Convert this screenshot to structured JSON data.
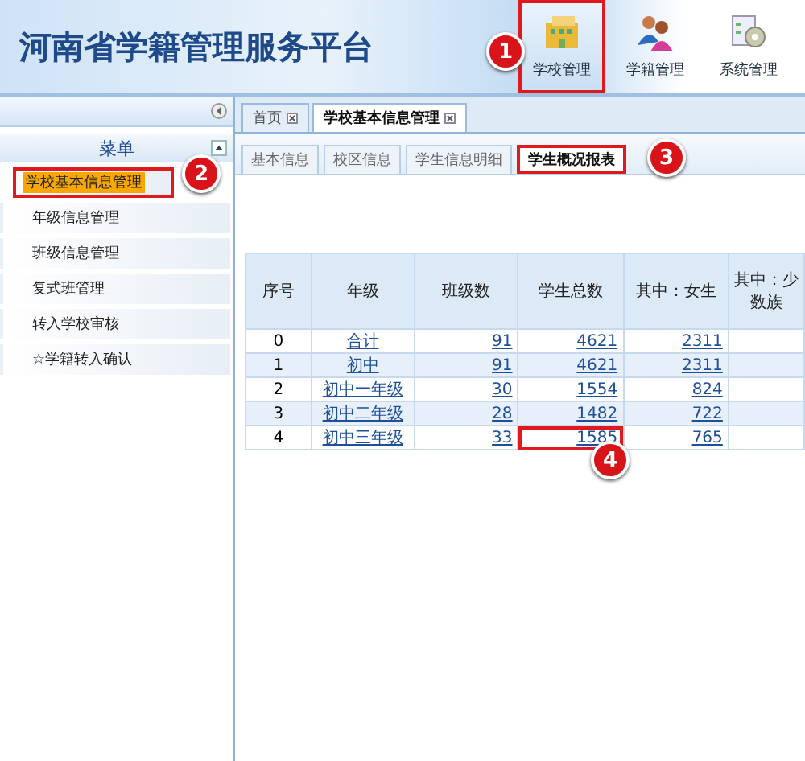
{
  "header": {
    "title": "河南省学籍管理服务平台",
    "nav": [
      {
        "label": "学校管理",
        "kind": "building",
        "selected": true,
        "marked": true
      },
      {
        "label": "学籍管理",
        "kind": "people",
        "selected": false,
        "marked": false
      },
      {
        "label": "系统管理",
        "kind": "gear",
        "selected": false,
        "marked": false
      }
    ]
  },
  "sidebar": {
    "title": "菜单",
    "items": [
      {
        "label": "学校基本信息管理",
        "selected": true,
        "marked": true
      },
      {
        "label": "年级信息管理",
        "selected": false,
        "marked": false
      },
      {
        "label": "班级信息管理",
        "selected": false,
        "marked": false
      },
      {
        "label": "复式班管理",
        "selected": false,
        "marked": false
      },
      {
        "label": "转入学校审核",
        "selected": false,
        "marked": false
      },
      {
        "label": "☆学籍转入确认",
        "selected": false,
        "marked": false
      }
    ]
  },
  "tabs": [
    {
      "label": "首页",
      "selected": false
    },
    {
      "label": "学校基本信息管理",
      "selected": true
    }
  ],
  "subtabs": [
    {
      "label": "基本信息",
      "selected": false,
      "marked": false
    },
    {
      "label": "校区信息",
      "selected": false,
      "marked": false
    },
    {
      "label": "学生信息明细",
      "selected": false,
      "marked": false
    },
    {
      "label": "学生概况报表",
      "selected": true,
      "marked": true
    }
  ],
  "table": {
    "columns": [
      "序号",
      "年级",
      "班级数",
      "学生总数",
      "其中：女生",
      "其中：少数族"
    ],
    "rows": [
      {
        "cells": [
          {
            "text": "0",
            "marked": false
          },
          {
            "text": "合计",
            "marked": false
          },
          {
            "text": "91",
            "marked": false
          },
          {
            "text": "4621",
            "marked": false
          },
          {
            "text": "2311",
            "marked": false
          }
        ]
      },
      {
        "cells": [
          {
            "text": "1",
            "marked": false
          },
          {
            "text": "初中",
            "marked": false
          },
          {
            "text": "91",
            "marked": false
          },
          {
            "text": "4621",
            "marked": false
          },
          {
            "text": "2311",
            "marked": false
          }
        ]
      },
      {
        "cells": [
          {
            "text": "2",
            "marked": false
          },
          {
            "text": "初中一年级",
            "marked": false
          },
          {
            "text": "30",
            "marked": false
          },
          {
            "text": "1554",
            "marked": false
          },
          {
            "text": "824",
            "marked": false
          }
        ]
      },
      {
        "cells": [
          {
            "text": "3",
            "marked": false
          },
          {
            "text": "初中二年级",
            "marked": false
          },
          {
            "text": "28",
            "marked": false
          },
          {
            "text": "1482",
            "marked": false
          },
          {
            "text": "722",
            "marked": false
          }
        ]
      },
      {
        "cells": [
          {
            "text": "4",
            "marked": false
          },
          {
            "text": "初中三年级",
            "marked": false
          },
          {
            "text": "33",
            "marked": false
          },
          {
            "text": "1585",
            "marked": true
          },
          {
            "text": "765",
            "marked": false
          }
        ]
      }
    ]
  },
  "annotations": [
    {
      "label": "1"
    },
    {
      "label": "2"
    },
    {
      "label": "3"
    },
    {
      "label": "4"
    }
  ]
}
